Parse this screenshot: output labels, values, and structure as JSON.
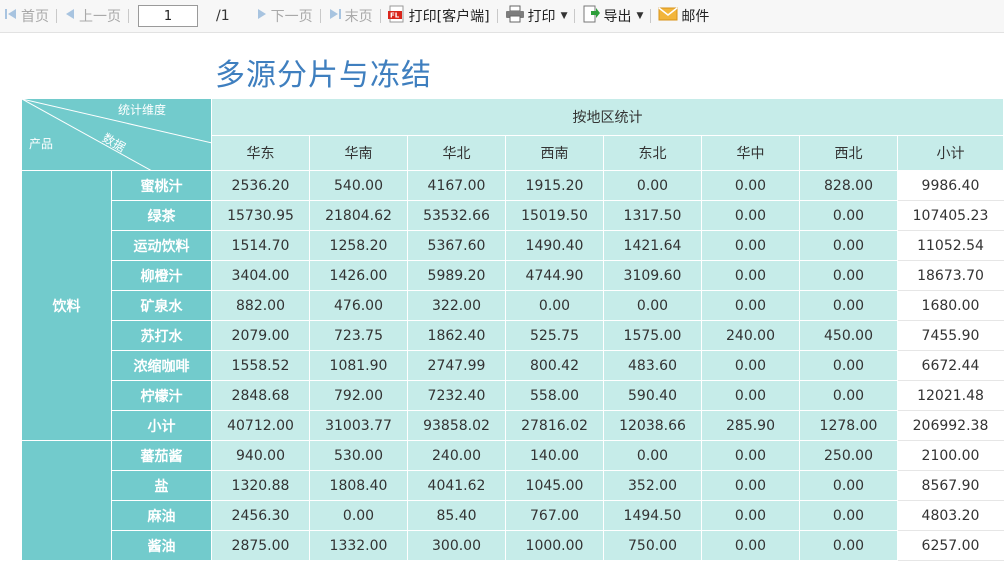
{
  "toolbar": {
    "first": "首页",
    "prev": "上一页",
    "page_value": "1",
    "page_total": "/1",
    "next": "下一页",
    "last": "末页",
    "print_client": "打印[客户端]",
    "print": "打印",
    "export": "导出",
    "mail": "邮件"
  },
  "report": {
    "title": "多源分片与冻结",
    "corner": {
      "top": "统计维度",
      "middle": "数据",
      "bottom": "产品"
    },
    "group_header": "按地区统计",
    "regions": [
      "华东",
      "华南",
      "华北",
      "西南",
      "东北",
      "华中",
      "西北"
    ],
    "subtotal_col": "小计",
    "categories": [
      {
        "name": "饮料",
        "rows": [
          {
            "product": "蜜桃汁",
            "values": [
              "2536.20",
              "540.00",
              "4167.00",
              "1915.20",
              "0.00",
              "0.00",
              "828.00"
            ],
            "total": "9986.40"
          },
          {
            "product": "绿茶",
            "values": [
              "15730.95",
              "21804.62",
              "53532.66",
              "15019.50",
              "1317.50",
              "0.00",
              "0.00"
            ],
            "total": "107405.23"
          },
          {
            "product": "运动饮料",
            "values": [
              "1514.70",
              "1258.20",
              "5367.60",
              "1490.40",
              "1421.64",
              "0.00",
              "0.00"
            ],
            "total": "11052.54"
          },
          {
            "product": "柳橙汁",
            "values": [
              "3404.00",
              "1426.00",
              "5989.20",
              "4744.90",
              "3109.60",
              "0.00",
              "0.00"
            ],
            "total": "18673.70"
          },
          {
            "product": "矿泉水",
            "values": [
              "882.00",
              "476.00",
              "322.00",
              "0.00",
              "0.00",
              "0.00",
              "0.00"
            ],
            "total": "1680.00"
          },
          {
            "product": "苏打水",
            "values": [
              "2079.00",
              "723.75",
              "1862.40",
              "525.75",
              "1575.00",
              "240.00",
              "450.00"
            ],
            "total": "7455.90"
          },
          {
            "product": "浓缩咖啡",
            "values": [
              "1558.52",
              "1081.90",
              "2747.99",
              "800.42",
              "483.60",
              "0.00",
              "0.00"
            ],
            "total": "6672.44"
          },
          {
            "product": "柠檬汁",
            "values": [
              "2848.68",
              "792.00",
              "7232.40",
              "558.00",
              "590.40",
              "0.00",
              "0.00"
            ],
            "total": "12021.48"
          },
          {
            "product": "小计",
            "values": [
              "40712.00",
              "31003.77",
              "93858.02",
              "27816.02",
              "12038.66",
              "285.90",
              "1278.00"
            ],
            "total": "206992.38"
          }
        ]
      },
      {
        "name": "",
        "rows": [
          {
            "product": "蕃茄酱",
            "values": [
              "940.00",
              "530.00",
              "240.00",
              "140.00",
              "0.00",
              "0.00",
              "250.00"
            ],
            "total": "2100.00"
          },
          {
            "product": "盐",
            "values": [
              "1320.88",
              "1808.40",
              "4041.62",
              "1045.00",
              "352.00",
              "0.00",
              "0.00"
            ],
            "total": "8567.90"
          },
          {
            "product": "麻油",
            "values": [
              "2456.30",
              "0.00",
              "85.40",
              "767.00",
              "1494.50",
              "0.00",
              "0.00"
            ],
            "total": "4803.20"
          },
          {
            "product": "酱油",
            "values": [
              "2875.00",
              "1332.00",
              "300.00",
              "1000.00",
              "750.00",
              "0.00",
              "0.00"
            ],
            "total": "6257.00"
          }
        ]
      }
    ]
  }
}
